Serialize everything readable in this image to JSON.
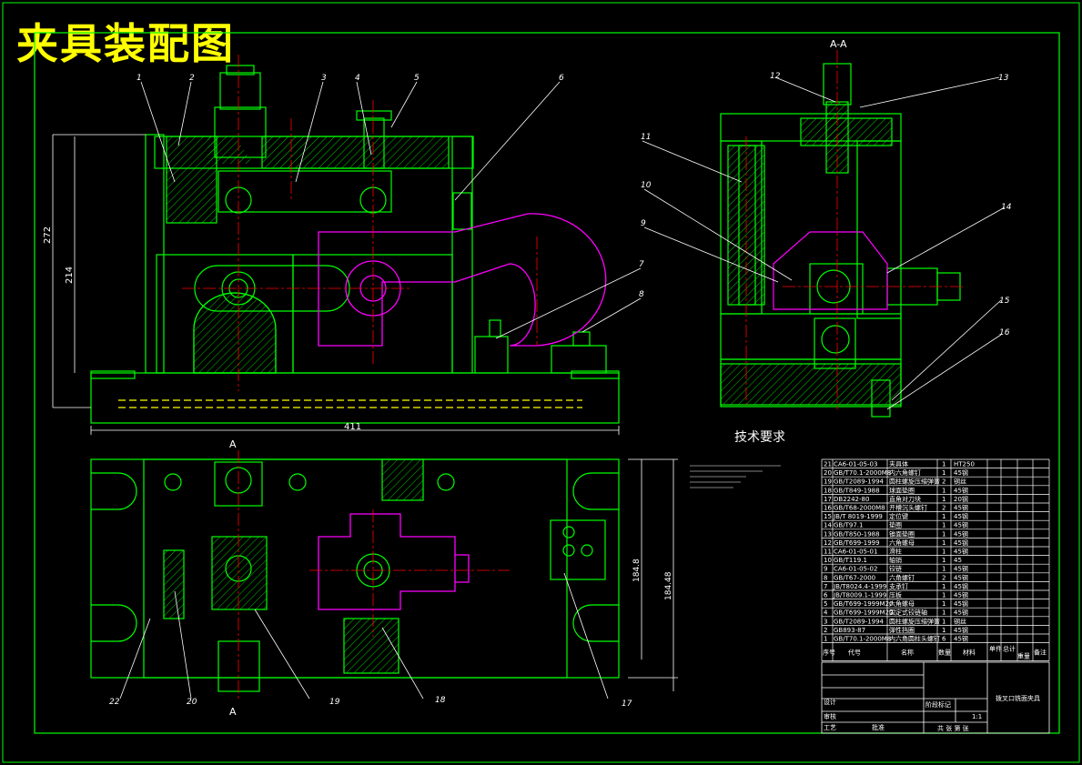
{
  "title": "夹具装配图",
  "section_label": "A-A",
  "section_mark": "A",
  "tech_requirements_title": "技术要求",
  "dimensions": {
    "overall_length": "411",
    "height_total": "272",
    "height_inner": "214",
    "dim_a": "184.8",
    "dim_b": "184.48"
  },
  "balloons": [
    "1",
    "2",
    "3",
    "4",
    "5",
    "6",
    "7",
    "8",
    "9",
    "10",
    "11",
    "12",
    "13",
    "14",
    "15",
    "16",
    "17",
    "18",
    "19",
    "20",
    "22"
  ],
  "bom": [
    {
      "no": "21",
      "code": "CA6-01-05-03",
      "name": "夹具体",
      "qty": "1",
      "mat": "HT250"
    },
    {
      "no": "20",
      "code": "GB/T70.1-2000M8",
      "name": "内六角螺钉",
      "qty": "1",
      "mat": "45钢"
    },
    {
      "no": "19",
      "code": "GB/T2089-1994",
      "name": "圆柱螺旋压缩弹簧",
      "qty": "2",
      "mat": "钢丝"
    },
    {
      "no": "18",
      "code": "GB/T849-1988",
      "name": "球面垫圈",
      "qty": "1",
      "mat": "45钢"
    },
    {
      "no": "17",
      "code": "DB2242-80",
      "name": "直角对刀块",
      "qty": "1",
      "mat": "20钢"
    },
    {
      "no": "16",
      "code": "GB/T68-2000M8",
      "name": "开槽沉头螺钉",
      "qty": "2",
      "mat": "45钢"
    },
    {
      "no": "15",
      "code": "JB/T 8019-1999",
      "name": "定位键",
      "qty": "1",
      "mat": "45钢"
    },
    {
      "no": "14",
      "code": "GB/T97.1",
      "name": "垫圈",
      "qty": "1",
      "mat": "45钢"
    },
    {
      "no": "13",
      "code": "GB/T850-1988",
      "name": "锥面垫圈",
      "qty": "1",
      "mat": "45钢"
    },
    {
      "no": "12",
      "code": "GB/T699-1999",
      "name": "六角螺母",
      "qty": "1",
      "mat": "45钢"
    },
    {
      "no": "11",
      "code": "CA6-01-05-01",
      "name": "滑柱",
      "qty": "1",
      "mat": "45钢"
    },
    {
      "no": "10",
      "code": "GB/T119.1",
      "name": "轴销",
      "qty": "1",
      "mat": "45"
    },
    {
      "no": "9",
      "code": "CA6-01-05-02",
      "name": "铰链",
      "qty": "1",
      "mat": "45钢"
    },
    {
      "no": "8",
      "code": "GB/T67-2000",
      "name": "六角螺钉",
      "qty": "2",
      "mat": "45钢"
    },
    {
      "no": "7",
      "code": "JB/T8024.4-1999",
      "name": "支承钉",
      "qty": "1",
      "mat": "45钢"
    },
    {
      "no": "6",
      "code": "JB/T8009.1-1999",
      "name": "压板",
      "qty": "1",
      "mat": "45钢"
    },
    {
      "no": "5",
      "code": "GB/T699-1999M20",
      "name": "六角螺母",
      "qty": "1",
      "mat": "45钢"
    },
    {
      "no": "4",
      "code": "GB/T699-1999M20",
      "name": "固定式铰链轴",
      "qty": "1",
      "mat": "45钢"
    },
    {
      "no": "3",
      "code": "GB/T2089-1994",
      "name": "圆柱螺旋压缩弹簧",
      "qty": "1",
      "mat": "钢丝"
    },
    {
      "no": "2",
      "code": "GB893-87",
      "name": "弹性挡圈",
      "qty": "1",
      "mat": "45钢"
    },
    {
      "no": "1",
      "code": "GB/T70.1-2000M8",
      "name": "内六角圆柱头螺钉",
      "qty": "6",
      "mat": "45钢"
    }
  ],
  "bom_header": {
    "no": "序号",
    "code": "代号",
    "name": "名称",
    "qty": "数量",
    "mat": "材料",
    "single": "单件",
    "total": "总计",
    "weight": "重量",
    "remark": "备注"
  },
  "title_block": {
    "drawing_name": "拨叉口铣面夹具",
    "scale": "1:1",
    "mark": "标记",
    "count": "处数",
    "zone": "分区",
    "change": "更改文件号",
    "sign": "签名",
    "date": "年月日",
    "design": "设计",
    "check": "审核",
    "process": "工艺",
    "approve": "批准",
    "std": "标准化",
    "stage": "阶段标记",
    "weight": "重量",
    "ratio": "比例",
    "sheets": "共 张 第 张"
  }
}
